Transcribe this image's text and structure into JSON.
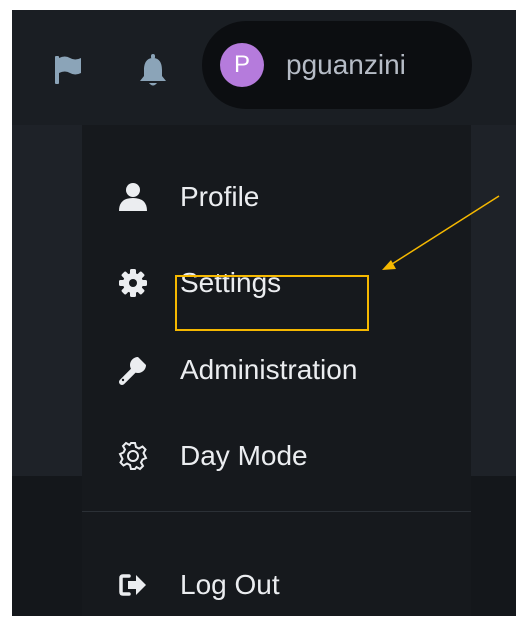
{
  "header": {
    "icons": {
      "flag": "flag-icon",
      "notifications": "bell-icon"
    },
    "user": {
      "avatar_initial": "P",
      "username": "pguanzini"
    }
  },
  "menu": {
    "items": [
      {
        "label": "Profile",
        "icon": "user-icon"
      },
      {
        "label": "Settings",
        "icon": "gear-icon"
      },
      {
        "label": "Administration",
        "icon": "wrench-icon"
      },
      {
        "label": "Day Mode",
        "icon": "gear-outline-icon"
      },
      {
        "label": "Log Out",
        "icon": "sign-out-icon"
      }
    ]
  },
  "annotation": {
    "color": "#f5b800"
  },
  "colors": {
    "accent_avatar": "#b57bdc",
    "text": "#ebedf0",
    "icon_muted": "#8ba4b8"
  }
}
